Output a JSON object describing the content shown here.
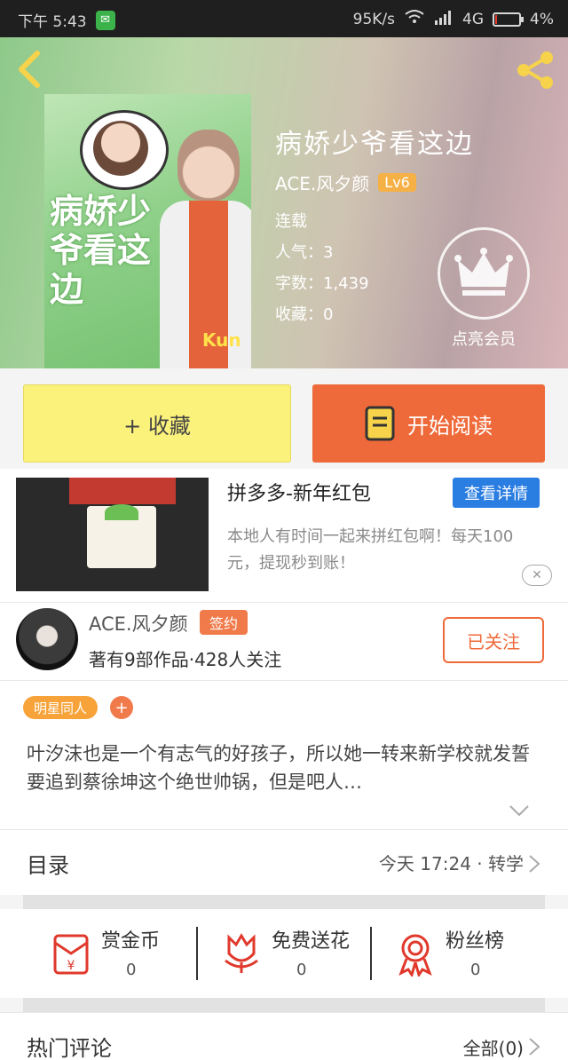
{
  "status_bar": {
    "time": "下午 5:43",
    "net_speed": "95K/s",
    "network": "4G",
    "battery": "4%",
    "battery_level": 0.04
  },
  "header": {
    "back_icon": "chevron-left-icon",
    "share_icon": "share-icon"
  },
  "book": {
    "cover_title": "病娇少爷看这边",
    "cover_badge": "Kun",
    "title": "病娇少爷看这边",
    "author": "ACE.风夕颜",
    "level": "Lv6",
    "status": "连载",
    "popularity": "人气：3",
    "word_count": "字数：1,439",
    "favorites": "收藏：0",
    "vip_label": "点亮会员"
  },
  "actions": {
    "collect_label": "+ 收藏",
    "read_label": "开始阅读"
  },
  "ad": {
    "title": "拼多多-新年红包",
    "detail_label": "查看详情",
    "description": "本地人有时间一起来拼红包啊！每天100元，提现秒到账！",
    "close_label": "✕"
  },
  "author_card": {
    "name": "ACE.风夕颜",
    "badge": "签约",
    "stats": "著有9部作品·428人关注",
    "follow_label": "已关注"
  },
  "tags": {
    "items": [
      "明星同人"
    ],
    "add_label": "+"
  },
  "synopsis": "叶汐沫也是一个有志气的好孩子，所以她一转来新学校就发誓要追到蔡徐坤这个绝世帅锅，但是吧人…",
  "catalog": {
    "label": "目录",
    "latest": "今天 17:24 · 转学"
  },
  "rewards": [
    {
      "label": "赏金币",
      "count": "0",
      "icon": "red-envelope-icon"
    },
    {
      "label": "免费送花",
      "count": "0",
      "icon": "flower-icon"
    },
    {
      "label": "粉丝榜",
      "count": "0",
      "icon": "medal-icon"
    }
  ],
  "hot_comments": {
    "label": "热门评论",
    "all_label": "全部(0)"
  },
  "colors": {
    "accent_orange": "#ef6a3a",
    "collect_yellow": "#fbf27b",
    "ad_blue": "#2a7de1",
    "tag_orange": "#f7a33a"
  }
}
